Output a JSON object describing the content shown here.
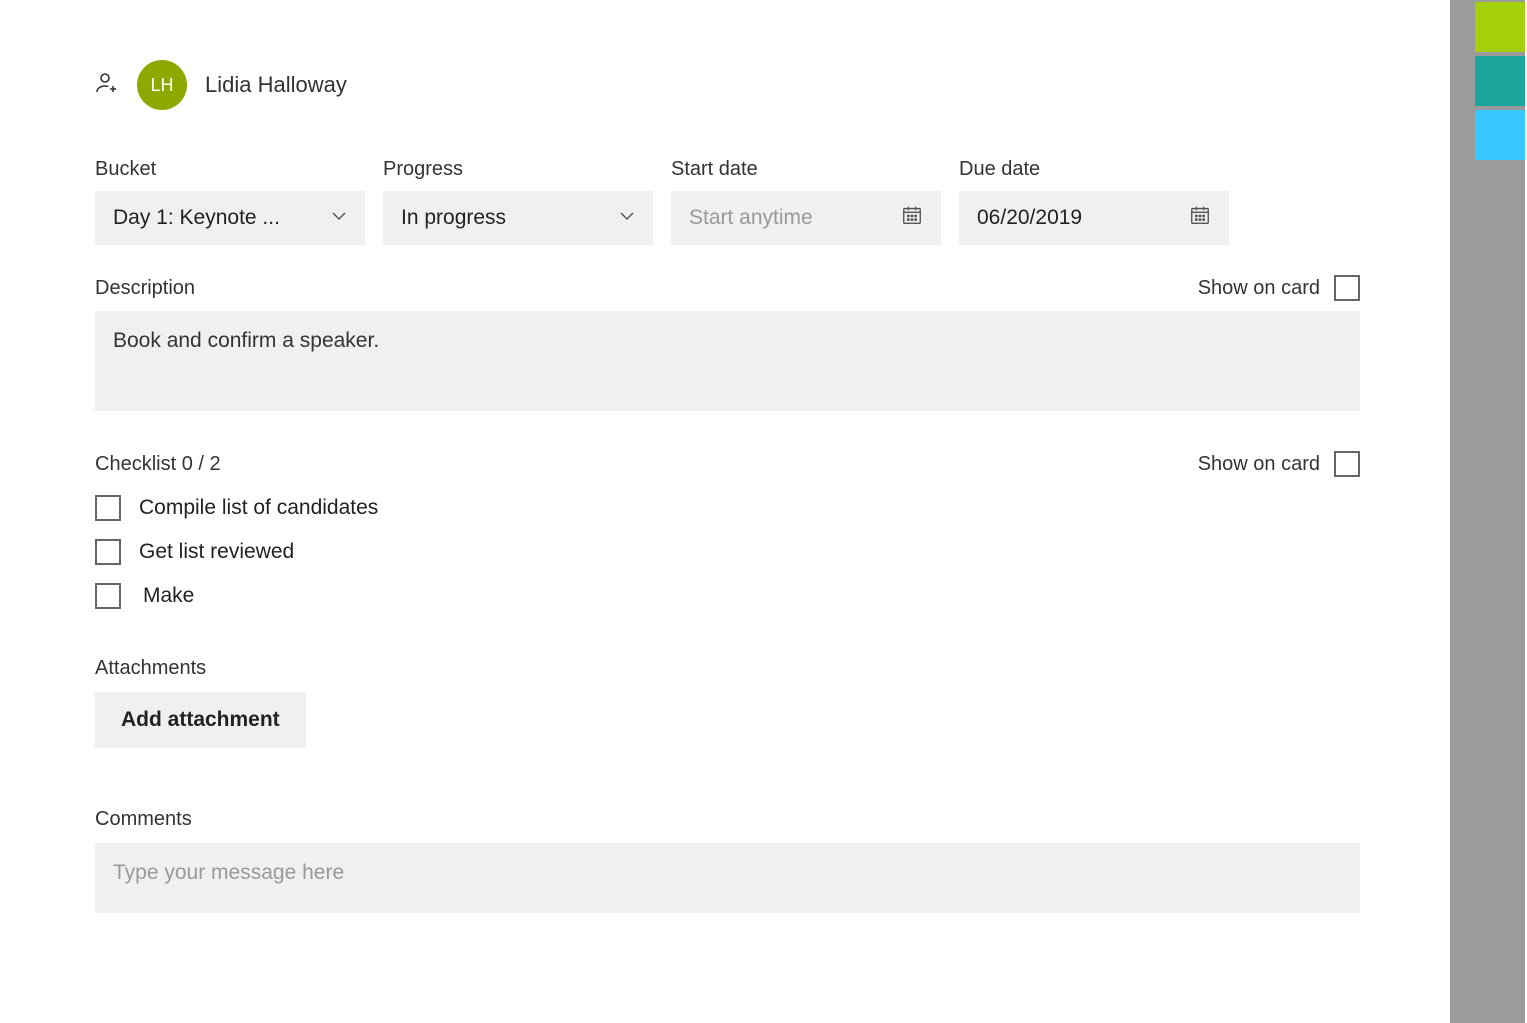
{
  "assignee": {
    "initials": "LH",
    "name": "Lidia Halloway"
  },
  "fields": {
    "bucket": {
      "label": "Bucket",
      "value": "Day 1: Keynote ..."
    },
    "progress": {
      "label": "Progress",
      "value": "In progress"
    },
    "start_date": {
      "label": "Start date",
      "placeholder": "Start anytime",
      "value": ""
    },
    "due_date": {
      "label": "Due date",
      "value": "06/20/2019"
    }
  },
  "description": {
    "label": "Description",
    "value": "Book and confirm a speaker.",
    "show_on_card_label": "Show on card"
  },
  "checklist": {
    "label": "Checklist 0 / 2",
    "show_on_card_label": "Show on card",
    "items": [
      {
        "label": "Compile list of candidates"
      },
      {
        "label": "Get list reviewed"
      },
      {
        "label": "Make"
      }
    ]
  },
  "attachments": {
    "label": "Attachments",
    "button": "Add attachment"
  },
  "comments": {
    "label": "Comments",
    "placeholder": "Type your message here"
  }
}
